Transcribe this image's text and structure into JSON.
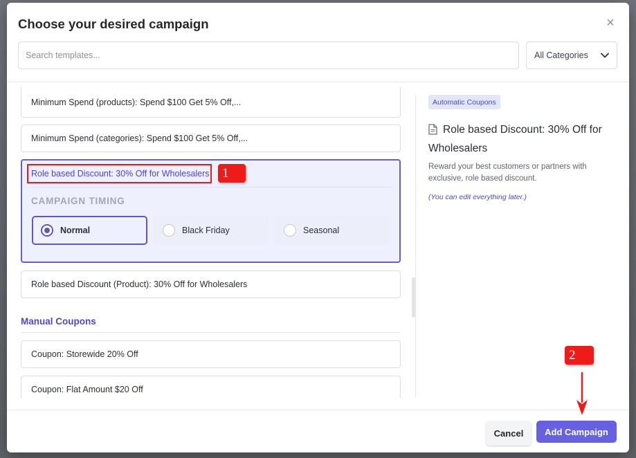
{
  "modal": {
    "title": "Choose your desired campaign",
    "close_label": "×"
  },
  "search": {
    "placeholder": "Search templates..."
  },
  "category_select": {
    "value": "All Categories"
  },
  "templates": {
    "items": [
      {
        "label": "Minimum Spend (products): Spend $100 Get 5% Off,..."
      },
      {
        "label": "Minimum Spend (categories): Spend $100 Get 5% Off,..."
      },
      {
        "label": "Role based Discount: 30% Off for Wholesalers"
      },
      {
        "label": "Role based Discount (Product): 30% Off for Wholesalers"
      }
    ],
    "timing_label": "CAMPAIGN TIMING",
    "timing_options": [
      {
        "label": "Normal",
        "selected": true
      },
      {
        "label": "Black Friday",
        "selected": false
      },
      {
        "label": "Seasonal",
        "selected": false
      }
    ]
  },
  "manual": {
    "title": "Manual Coupons",
    "items": [
      {
        "label": "Coupon: Storewide 20% Off"
      },
      {
        "label": "Coupon: Flat Amount $20 Off"
      }
    ]
  },
  "detail": {
    "badge": "Automatic Coupons",
    "title": "Role based Discount: 30% Off for Wholesalers",
    "description": "Reward your best customers or partners with exclusive, role based discount.",
    "note": "(You can edit everything later.)"
  },
  "footer": {
    "cancel_label": "Cancel",
    "add_label": "Add Campaign"
  },
  "annotations": {
    "step1": "1",
    "step2": "2"
  },
  "colors": {
    "accent": "#6760e0",
    "selected_border": "#6560c9",
    "annotation": "#ef1a1a"
  }
}
